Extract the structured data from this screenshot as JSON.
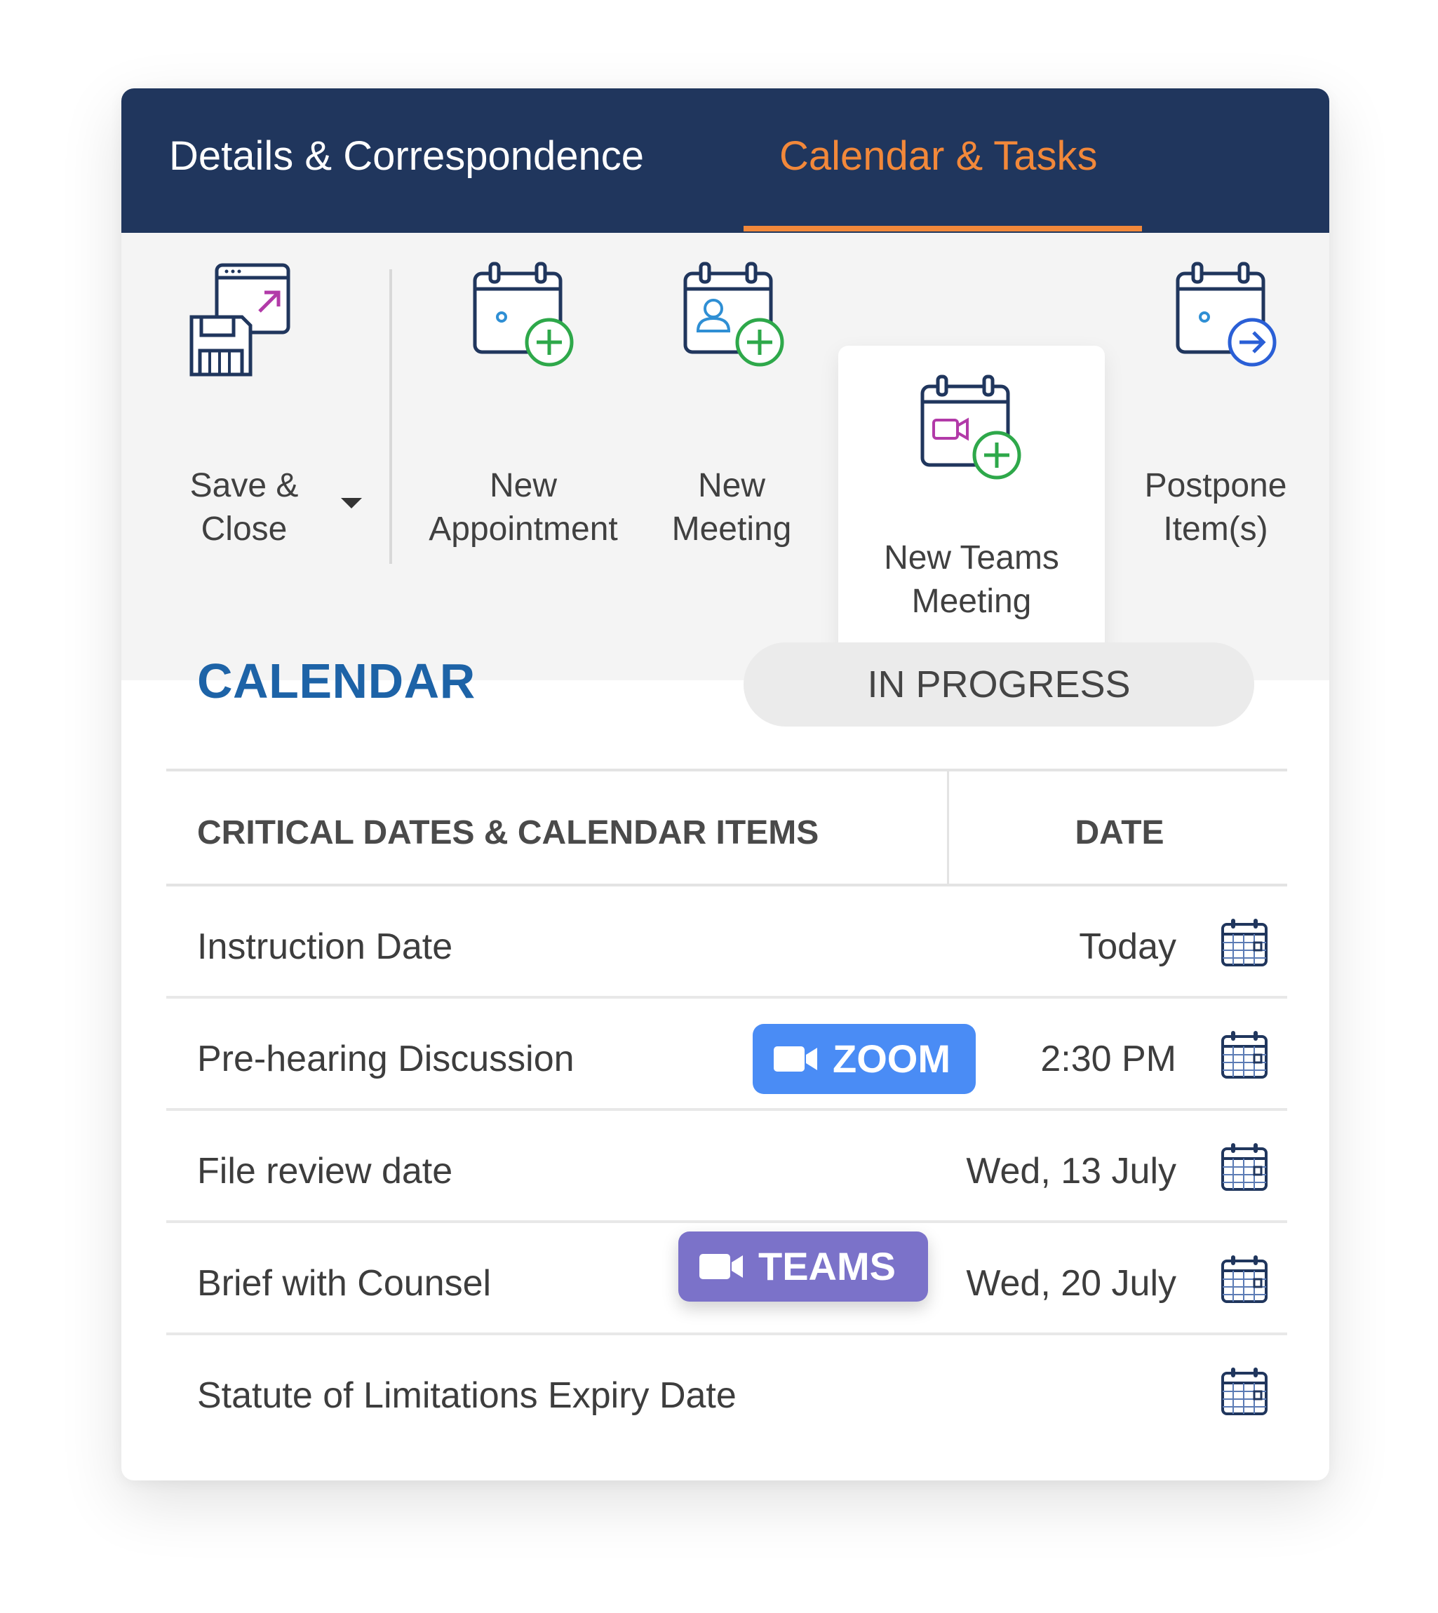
{
  "tabs": {
    "details": "Details & Correspondence",
    "calendar": "Calendar & Tasks"
  },
  "ribbon": {
    "save_close": "Save & Close",
    "new_appointment": "New Appointment",
    "new_meeting": "New Meeting",
    "new_teams_meeting": "New Teams Meeting",
    "postpone": "Postpone Item(s)"
  },
  "section": {
    "title": "CALENDAR",
    "status": "IN PROGRESS"
  },
  "table": {
    "headers": [
      "CRITICAL DATES & CALENDAR ITEMS",
      "DATE"
    ],
    "rows": [
      {
        "label": "Instruction Date",
        "date": "Today",
        "badge": ""
      },
      {
        "label": "Pre-hearing Discussion",
        "date": "2:30 PM",
        "badge": "ZOOM"
      },
      {
        "label": "File review date",
        "date": "Wed, 13 July",
        "badge": ""
      },
      {
        "label": "Brief with Counsel",
        "date": "Wed, 20 July",
        "badge": "TEAMS"
      },
      {
        "label": "Statute of Limitations Expiry Date",
        "date": "",
        "badge": ""
      }
    ]
  },
  "colors": {
    "navy": "#20365d",
    "orange": "#f2883a",
    "calendar_blue": "#1d63a7",
    "zoom_blue": "#4a8cf5",
    "teams_purple": "#7b72c9",
    "plus_green": "#2ea84a"
  },
  "icons": {
    "save_close": "save-close-icon",
    "new_appointment": "calendar-plus-icon",
    "new_meeting": "calendar-person-plus-icon",
    "new_teams_meeting": "calendar-video-plus-icon",
    "postpone": "calendar-arrow-icon",
    "row_calendar": "calendar-grid-icon",
    "video": "video-camera-icon"
  }
}
